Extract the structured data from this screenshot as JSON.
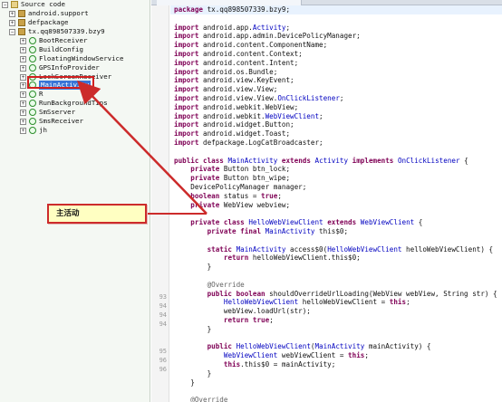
{
  "tree": {
    "root_label": "Source code",
    "items": [
      {
        "label": "android.support",
        "kind": "package"
      },
      {
        "label": "defpackage",
        "kind": "package"
      },
      {
        "label": "tx.qq898507339.bzy9",
        "kind": "package"
      },
      {
        "label": "BootReceiver",
        "kind": "class"
      },
      {
        "label": "BuildConfig",
        "kind": "class"
      },
      {
        "label": "FloatingWindowService",
        "kind": "class"
      },
      {
        "label": "GPSInfoProvider",
        "kind": "class"
      },
      {
        "label": "LockScreenReceiver",
        "kind": "class"
      },
      {
        "label": "MainActivity",
        "kind": "class",
        "selected": true
      },
      {
        "label": "R",
        "kind": "class"
      },
      {
        "label": "RunBackgroundTips",
        "kind": "class"
      },
      {
        "label": "SmSserver",
        "kind": "class"
      },
      {
        "label": "SmsReceiver",
        "kind": "class"
      },
      {
        "label": "jh",
        "kind": "class"
      }
    ]
  },
  "annotation": {
    "label": "主活动",
    "color": "#cc2b2b"
  },
  "editor": {
    "line_numbers": [
      "93",
      "94",
      "94",
      "94",
      "95",
      "96",
      "96"
    ],
    "lines": [
      "package tx.qq898507339.bzy9;",
      "",
      "import android.app.Activity;",
      "import android.app.admin.DevicePolicyManager;",
      "import android.content.ComponentName;",
      "import android.content.Context;",
      "import android.content.Intent;",
      "import android.os.Bundle;",
      "import android.view.KeyEvent;",
      "import android.view.View;",
      "import android.view.View.OnClickListener;",
      "import android.webkit.WebView;",
      "import android.webkit.WebViewClient;",
      "import android.widget.Button;",
      "import android.widget.Toast;",
      "import defpackage.LogCatBroadcaster;",
      "",
      "public class MainActivity extends Activity implements OnClickListener {",
      "    private Button btn_lock;",
      "    private Button btn_wipe;",
      "    DevicePolicyManager manager;",
      "    boolean status = true;",
      "    private WebView webview;",
      "",
      "    private class HelloWebViewClient extends WebViewClient {",
      "        private final MainActivity this$0;",
      "",
      "        static MainActivity access$0(HelloWebViewClient helloWebViewClient) {",
      "            return helloWebViewClient.this$0;",
      "        }",
      "",
      "        @Override",
      "        public boolean shouldOverrideUrlLoading(WebView webView, String str) {",
      "            HelloWebViewClient helloWebViewClient = this;",
      "            webView.loadUrl(str);",
      "            return true;",
      "        }",
      "",
      "        public HelloWebViewClient(MainActivity mainActivity) {",
      "            WebViewClient webViewClient = this;",
      "            this.this$0 = mainActivity;",
      "        }",
      "    }",
      "",
      "    @Override"
    ]
  }
}
